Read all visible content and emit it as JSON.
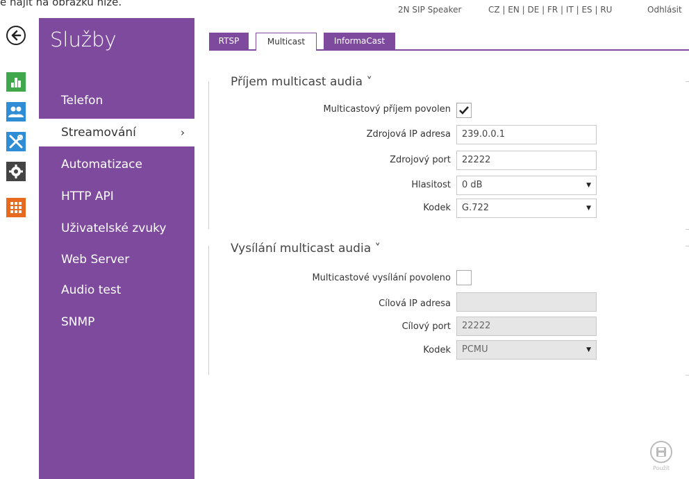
{
  "intro_text": "e najít na obrázku níže.",
  "header": {
    "device_name": "2N SIP Speaker",
    "languages": "CZ | EN | DE | FR | IT | ES | RU",
    "logout": "Odhlásit"
  },
  "sidebar": {
    "title": "Služby",
    "items": [
      {
        "label": "Telefon"
      },
      {
        "label": "Streamování",
        "chevron": "›"
      },
      {
        "label": "Automatizace"
      },
      {
        "label": "HTTP API"
      },
      {
        "label": "Uživatelské zvuky"
      },
      {
        "label": "Web Server"
      },
      {
        "label": "Audio test"
      },
      {
        "label": "SNMP"
      }
    ]
  },
  "left_icons": [
    "back-arrow-icon",
    "status-chart-icon",
    "users-icon",
    "tools-icon",
    "gear-icon",
    "grid-icon"
  ],
  "tabs": [
    {
      "label": "RTSP"
    },
    {
      "label": "Multicast"
    },
    {
      "label": "InformaCast"
    }
  ],
  "receive": {
    "title": "Příjem multicast audia ˅",
    "enabled_label": "Multicastový příjem povolen",
    "enabled": true,
    "source_ip_label": "Zdrojová IP adresa",
    "source_ip": "239.0.0.1",
    "source_port_label": "Zdrojový port",
    "source_port": "22222",
    "volume_label": "Hlasitost",
    "volume": "0 dB",
    "codec_label": "Kodek",
    "codec": "G.722"
  },
  "transmit": {
    "title": "Vysílání multicast audia ˅",
    "enabled_label": "Multicastové vysílání povoleno",
    "enabled": false,
    "target_ip_label": "Cílová IP adresa",
    "target_ip": "",
    "target_port_label": "Cílový port",
    "target_port": "22222",
    "codec_label": "Kodek",
    "codec": "PCMU"
  },
  "save": {
    "label": "Použít"
  },
  "colors": {
    "accent": "#7e4a9d",
    "green": "#3ea84a",
    "blue": "#2f8dd6",
    "orange": "#e66a1f",
    "dark": "#444444"
  }
}
